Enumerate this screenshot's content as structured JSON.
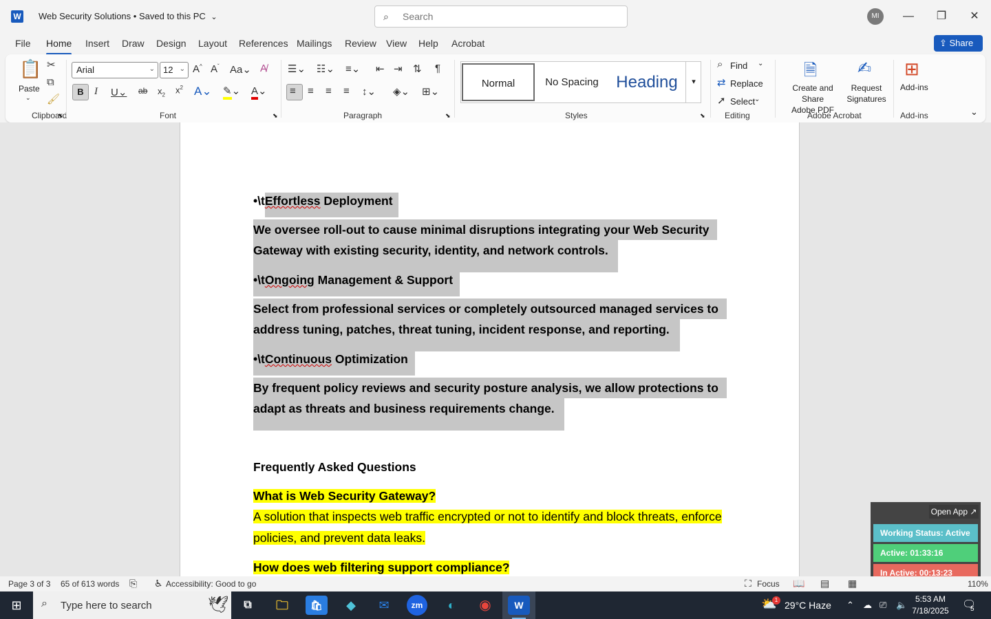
{
  "app": {
    "logo_letter": "W",
    "title": "Web Security Solutions",
    "save_status": "Saved to this PC",
    "search_placeholder": "Search",
    "user_initials": "MI"
  },
  "menu": {
    "tabs": [
      "File",
      "Home",
      "Insert",
      "Draw",
      "Design",
      "Layout",
      "References",
      "Mailings",
      "Review",
      "View",
      "Help",
      "Acrobat"
    ],
    "active": "Home",
    "share_label": "Share"
  },
  "ribbon": {
    "paste_label": "Paste",
    "font_name": "Arial",
    "font_size": "12",
    "styles": {
      "normal": "Normal",
      "no_spacing": "No Spacing",
      "heading": "Heading"
    },
    "editing": {
      "find": "Find",
      "replace": "Replace",
      "select": "Select"
    },
    "acrobat": {
      "create_share_1": "Create and Share",
      "create_share_2": "Adobe PDF",
      "request_1": "Request",
      "request_2": "Signatures"
    },
    "addins_label": "Add-ins",
    "groups": {
      "clipboard": "Clipboard",
      "font": "Font",
      "paragraph": "Paragraph",
      "styles": "Styles",
      "editing": "Editing",
      "adobe_acrobat": "Adobe Acrobat",
      "addins": "Add-ins"
    }
  },
  "document": {
    "bullet1_prefix": "•\\t",
    "bullet1_word": "Effortless",
    "bullet1_rest": " Deployment",
    "para1_line1": "We oversee roll-out to cause minimal disruptions integrating your Web Security",
    "para1_line2": "Gateway with existing security, identity, and network controls.",
    "bullet2_prefix": "•\\t",
    "bullet2_word": "Ongoing",
    "bullet2_rest": " Management & Support",
    "para2_line1": "Select from professional services or completely outsourced managed services to",
    "para2_line2": "address tuning, patches, threat tuning, incident response, and reporting.",
    "bullet3_prefix": "•\\t",
    "bullet3_word": "Continuous",
    "bullet3_rest": " Optimization",
    "para3_line1": "By frequent policy reviews and security posture analysis, we allow protections to",
    "para3_line2": "adapt as threats and business requirements change.",
    "faq_heading": "Frequently Asked Questions",
    "q1": "What is Web Security Gateway?",
    "a1_line1": "A solution that inspects web traffic encrypted or not to identify and block threats, enforce",
    "a1_line2": "policies, and prevent data leaks.",
    "q2": "How does web filtering support compliance?"
  },
  "tracker": {
    "open_app": "Open App ↗",
    "working_status": "Working Status: Active",
    "active": "Active: 01:33:16",
    "inactive": "In Active: 00:13:23",
    "colors": {
      "working": "#5bbfc9",
      "active": "#4fcf7a",
      "inactive": "#e8695e"
    }
  },
  "statusbar": {
    "page": "Page 3 of 3",
    "words": "65 of 613 words",
    "accessibility": "Accessibility: Good to go",
    "focus": "Focus",
    "zoom": "110%"
  },
  "taskbar": {
    "search_placeholder": "Type here to search",
    "weather": "29°C  Haze",
    "weather_badge": "1",
    "time": "5:53 AM",
    "date": "7/18/2025",
    "notifications": "5",
    "zoom_app": "zm"
  }
}
